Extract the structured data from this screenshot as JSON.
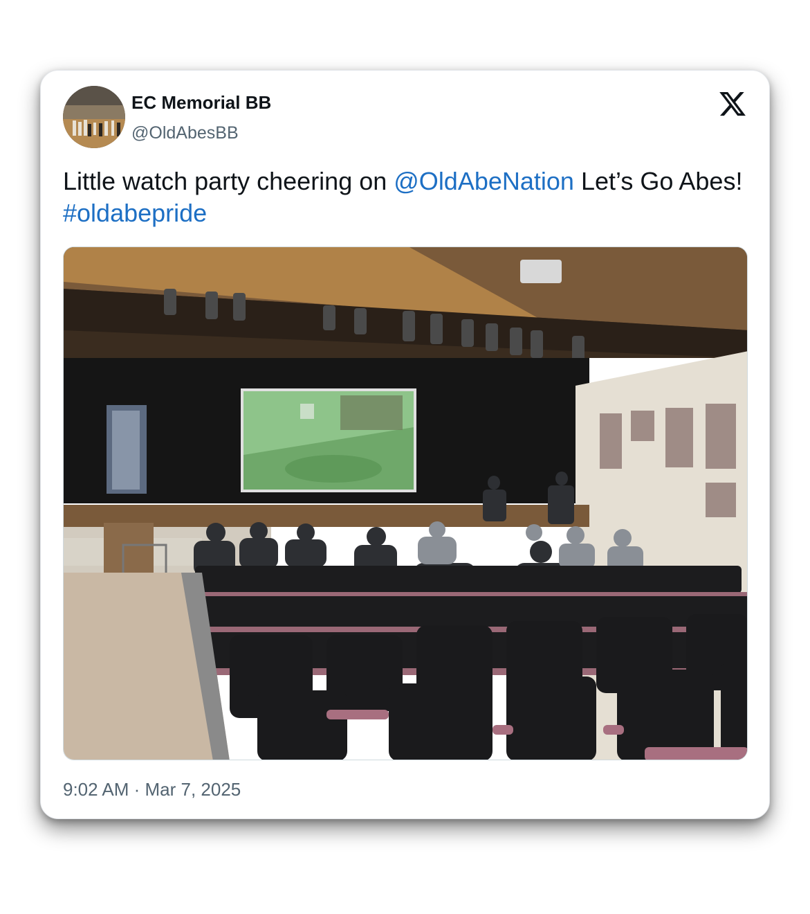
{
  "tweet": {
    "author_name": "EC Memorial BB",
    "author_handle": "@OldAbesBB",
    "text_part1": "Little watch party cheering on ",
    "mention": "@OldAbeNation",
    "text_part2": " Let’s Go Abes! ",
    "hashtag": "#oldabepride",
    "timestamp": "9:02 AM · Mar 7, 2025"
  },
  "icons": {
    "platform": "x-logo-icon"
  },
  "colors": {
    "link": "#1d6fc4",
    "text": "#0f1419",
    "secondary": "#536471"
  }
}
